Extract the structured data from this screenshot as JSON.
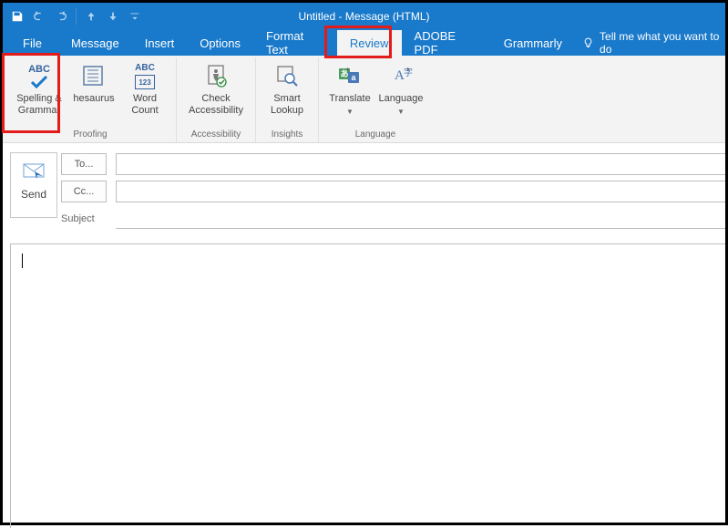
{
  "window": {
    "title": "Untitled  -  Message (HTML)"
  },
  "qat": {
    "save": "Save",
    "undo": "Undo",
    "redo": "Redo",
    "prev": "Previous",
    "next": "Next",
    "customize": "Customize"
  },
  "menu": {
    "file": "File",
    "message": "Message",
    "insert": "Insert",
    "options": "Options",
    "format_text": "Format Text",
    "review": "Review",
    "adobe_pdf": "ADOBE PDF",
    "grammarly": "Grammarly",
    "tellme": "Tell me what you want to do"
  },
  "ribbon": {
    "spelling": "Spelling &\nGrammar",
    "thesaurus": "hesaurus",
    "word_count": "Word\nCount",
    "check_access": "Check\nAccessibility",
    "smart_lookup": "Smart\nLookup",
    "translate": "Translate",
    "language": "Language",
    "group_proofing": "Proofing",
    "group_access": "Accessibility",
    "group_insights": "Insights",
    "group_language": "Language"
  },
  "compose": {
    "send": "Send",
    "to": "To...",
    "cc": "Cc...",
    "subject": "Subject",
    "to_value": "",
    "cc_value": "",
    "subject_value": "",
    "body": ""
  }
}
